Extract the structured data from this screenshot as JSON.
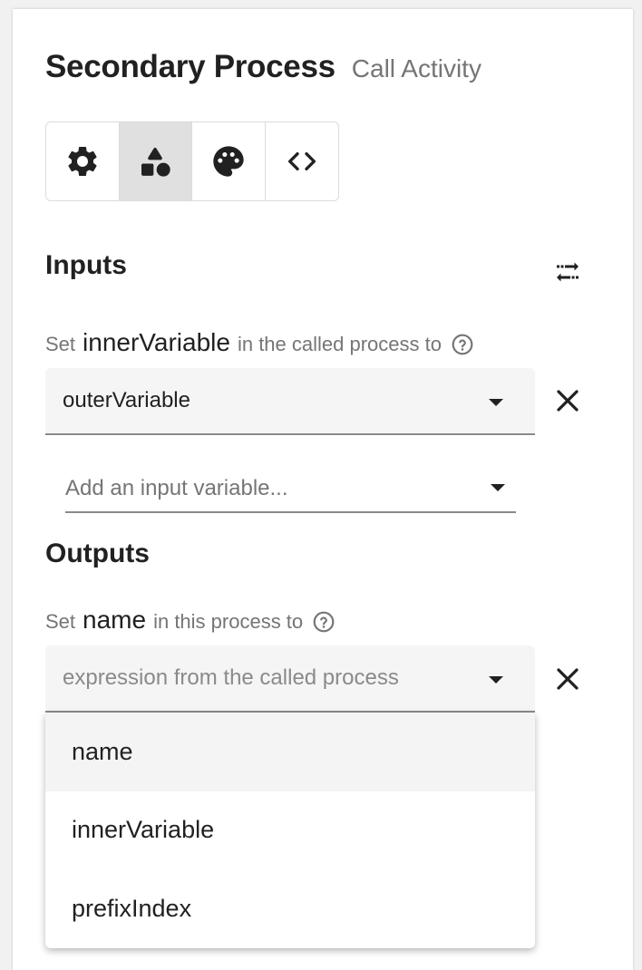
{
  "header": {
    "title": "Secondary Process",
    "subtitle": "Call Activity"
  },
  "toolbar": {
    "buttons": [
      {
        "name": "settings",
        "icon": "gear-icon",
        "active": false
      },
      {
        "name": "shapes",
        "icon": "shapes-icon",
        "active": true
      },
      {
        "name": "appearance",
        "icon": "palette-icon",
        "active": false
      },
      {
        "name": "code",
        "icon": "code-icon",
        "active": false
      }
    ]
  },
  "inputs": {
    "title": "Inputs",
    "swap_icon": "swap-horizontal-icon",
    "mapping": {
      "prefix": "Set",
      "variable": "innerVariable",
      "suffix": "in the called process to",
      "selected_value": "outerVariable"
    },
    "add_placeholder": "Add an input variable..."
  },
  "outputs": {
    "title": "Outputs",
    "mapping": {
      "prefix": "Set",
      "variable": "name",
      "suffix": "in this process to",
      "placeholder": "expression from the called process"
    },
    "options": [
      "name",
      "innerVariable",
      "prefixIndex"
    ],
    "highlighted_option": "name"
  },
  "colors": {
    "active_tab_bg": "#e0e0e0",
    "field_bg": "#f5f5f5",
    "text_primary": "#212121",
    "text_secondary": "#757575"
  }
}
